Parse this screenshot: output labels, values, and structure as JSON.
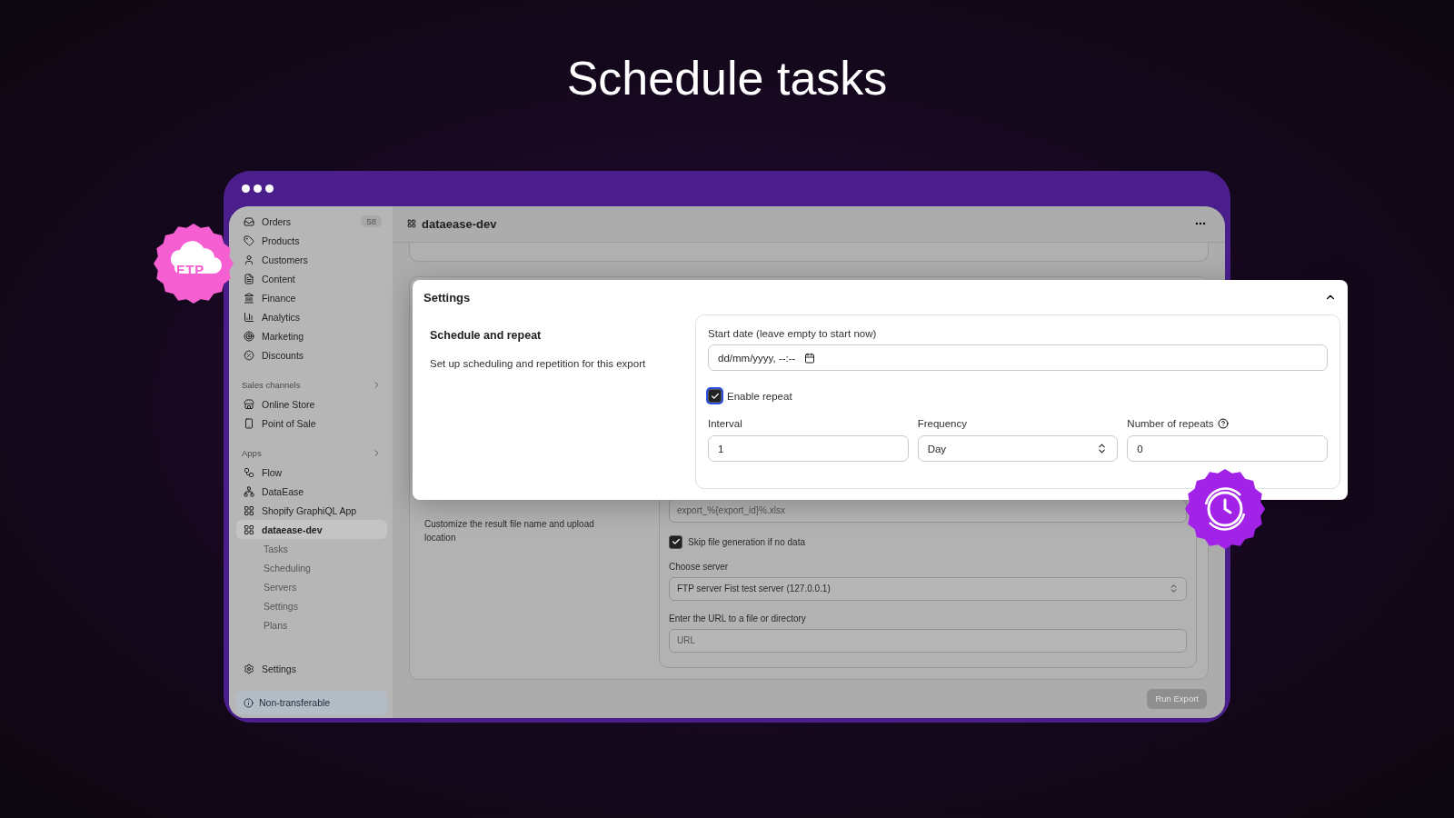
{
  "headline": "Schedule tasks",
  "sidebar": {
    "items": [
      {
        "label": "Orders",
        "badge": "58",
        "selected": false
      },
      {
        "label": "Products",
        "selected": false
      },
      {
        "label": "Customers",
        "selected": false
      },
      {
        "label": "Content",
        "selected": false
      },
      {
        "label": "Finance",
        "selected": false
      },
      {
        "label": "Analytics",
        "selected": false
      },
      {
        "label": "Marketing",
        "selected": false
      },
      {
        "label": "Discounts",
        "selected": false
      }
    ],
    "sections": [
      {
        "title": "Sales channels",
        "items": [
          {
            "label": "Online Store",
            "selected": false
          },
          {
            "label": "Point of Sale",
            "selected": false
          }
        ]
      },
      {
        "title": "Apps",
        "items": [
          {
            "label": "Flow",
            "selected": false
          },
          {
            "label": "DataEase",
            "selected": false
          },
          {
            "label": "Shopify GraphiQL App",
            "selected": false
          },
          {
            "label": "dataease-dev",
            "selected": true,
            "children": [
              {
                "label": "Tasks",
                "selected": false
              },
              {
                "label": "Scheduling",
                "selected": false
              },
              {
                "label": "Servers",
                "selected": false
              },
              {
                "label": "Settings",
                "selected": false
              },
              {
                "label": "Plans",
                "selected": false
              }
            ]
          }
        ]
      }
    ],
    "footer_item": "Settings",
    "notice": "Non-transferable"
  },
  "page": {
    "title": "dataease-dev",
    "output": {
      "description": "Customize the result file name and upload location",
      "filename_value": "export_%{export_id}%.xlsx",
      "skip": {
        "label": "Skip file generation if no data",
        "checked": true
      },
      "server": {
        "label": "Choose server",
        "value": "FTP server Fist test server (127.0.0.1)"
      },
      "url": {
        "label": "Enter the URL to a file or directory",
        "placeholder": "URL"
      }
    },
    "run_button": {
      "label": "Run Export",
      "disabled": true
    }
  },
  "popup": {
    "title": "Settings",
    "expanded": true,
    "section_title": "Schedule and repeat",
    "section_description": "Set up scheduling and repetition for this export",
    "start_date": {
      "label": "Start date (leave empty to start now)",
      "value": "dd/mm/yyyy, --:--"
    },
    "enable_repeat": {
      "label": "Enable repeat",
      "checked": true
    },
    "fields": [
      {
        "kind": "text",
        "label": "Interval",
        "value": "1"
      },
      {
        "kind": "select",
        "label": "Frequency",
        "value": "Day"
      },
      {
        "kind": "help",
        "label": "Number of repeats",
        "value": "0"
      }
    ]
  },
  "ftp_badge": {
    "label": "FTP"
  }
}
